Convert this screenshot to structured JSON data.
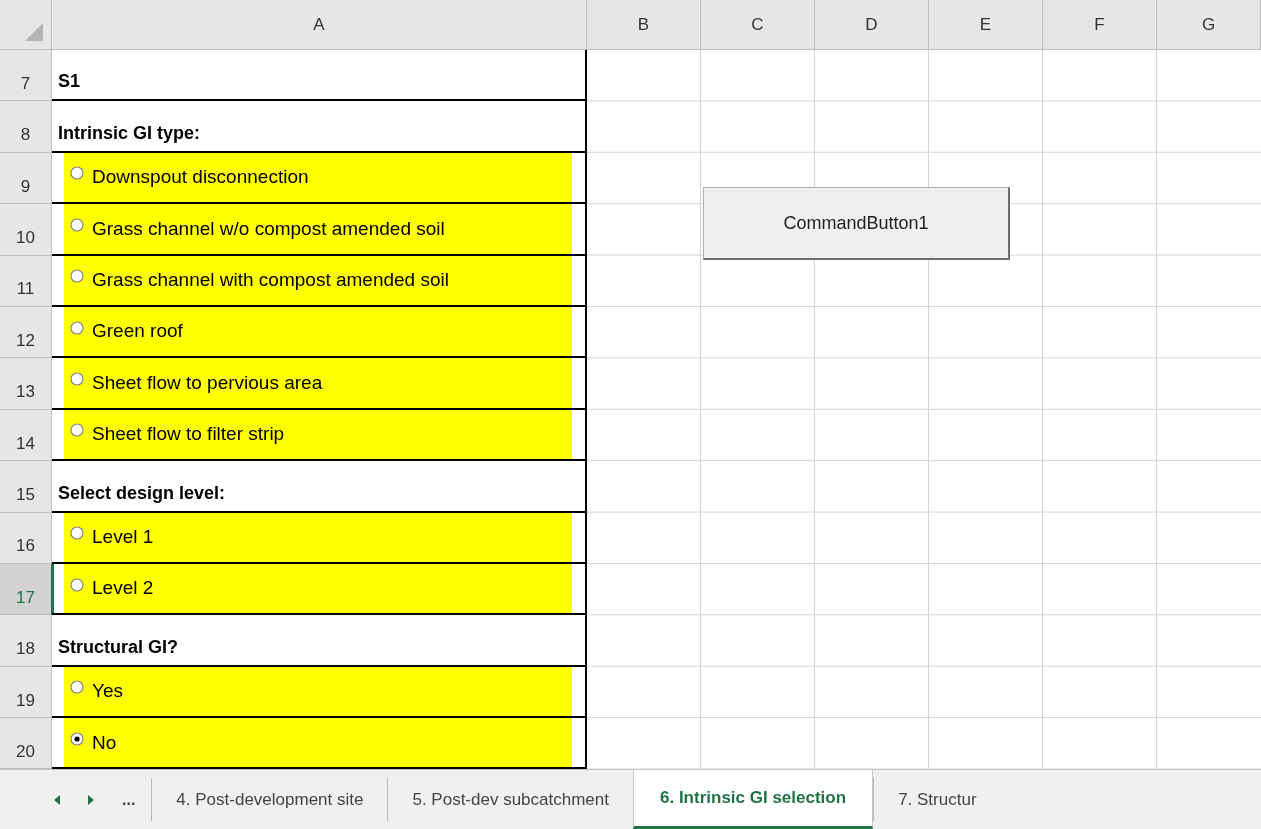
{
  "columns": [
    "A",
    "B",
    "C",
    "D",
    "E",
    "F",
    "G"
  ],
  "rows": [
    {
      "number": "7",
      "selected": false,
      "kind": "label",
      "text": "S1"
    },
    {
      "number": "8",
      "selected": false,
      "kind": "label",
      "text": "Intrinsic GI type:"
    },
    {
      "number": "9",
      "selected": false,
      "kind": "option",
      "text": "Downspout disconnection",
      "checked": false
    },
    {
      "number": "10",
      "selected": false,
      "kind": "option",
      "text": "Grass channel w/o compost amended soil",
      "checked": false
    },
    {
      "number": "11",
      "selected": false,
      "kind": "option",
      "text": "Grass channel with compost amended soil",
      "checked": false
    },
    {
      "number": "12",
      "selected": false,
      "kind": "option",
      "text": "Green roof",
      "checked": false
    },
    {
      "number": "13",
      "selected": false,
      "kind": "option",
      "text": "Sheet flow to pervious area",
      "checked": false
    },
    {
      "number": "14",
      "selected": false,
      "kind": "option",
      "text": "Sheet flow to filter strip",
      "checked": false
    },
    {
      "number": "15",
      "selected": false,
      "kind": "label",
      "text": "Select design level:"
    },
    {
      "number": "16",
      "selected": false,
      "kind": "option",
      "text": "Level 1",
      "checked": false
    },
    {
      "number": "17",
      "selected": true,
      "kind": "option",
      "text": "Level 2",
      "checked": false
    },
    {
      "number": "18",
      "selected": false,
      "kind": "label",
      "text": "Structural GI?"
    },
    {
      "number": "19",
      "selected": false,
      "kind": "option",
      "text": "Yes",
      "checked": false
    },
    {
      "number": "20",
      "selected": false,
      "kind": "option",
      "text": "No",
      "checked": true
    }
  ],
  "command_button": {
    "label": "CommandButton1"
  },
  "tab_bar": {
    "more": "...",
    "tabs": [
      {
        "label": "4. Post-development site",
        "selected": false
      },
      {
        "label": "5. Post-dev subcatchment",
        "selected": false
      },
      {
        "label": "6. Intrinsic GI selection",
        "selected": true
      },
      {
        "label": "7. Structur",
        "selected": false
      }
    ]
  }
}
